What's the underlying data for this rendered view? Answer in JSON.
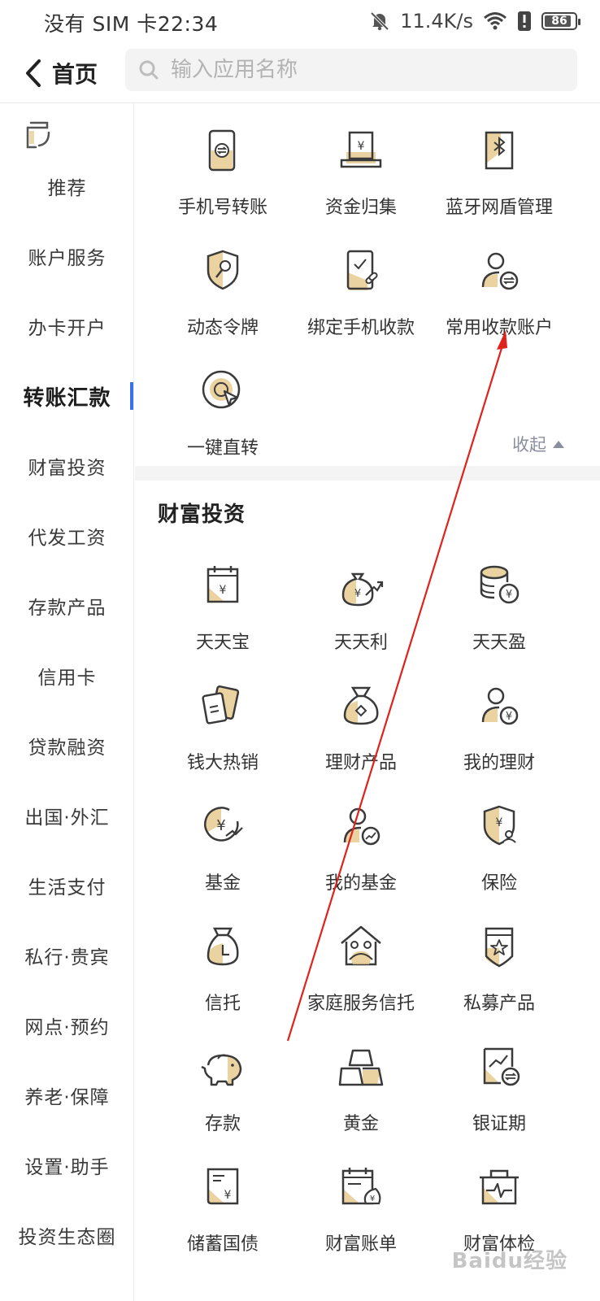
{
  "status_bar": {
    "left_text": "没有 SIM 卡22:34",
    "speed": "11.4K/s",
    "battery": "86"
  },
  "header": {
    "back_label": "首页",
    "search_placeholder": "输入应用名称"
  },
  "sidebar": {
    "items": [
      {
        "label": "推荐"
      },
      {
        "label": "账户服务"
      },
      {
        "label": "办卡开户"
      },
      {
        "label": "转账汇款",
        "active": true
      },
      {
        "label": "财富投资"
      },
      {
        "label": "代发工资"
      },
      {
        "label": "存款产品"
      },
      {
        "label": "信用卡"
      },
      {
        "label": "贷款融资"
      },
      {
        "label": "出国·外汇"
      },
      {
        "label": "生活支付"
      },
      {
        "label": "私行·贵宾"
      },
      {
        "label": "网点·预约"
      },
      {
        "label": "养老·保障"
      },
      {
        "label": "设置·助手"
      },
      {
        "label": "投资生态圈"
      }
    ]
  },
  "transfer_section": {
    "items": [
      {
        "label": "手机号转账",
        "icon": "phone-transfer-icon"
      },
      {
        "label": "资金归集",
        "icon": "fund-collection-icon"
      },
      {
        "label": "蓝牙网盾管理",
        "icon": "bluetooth-shield-icon"
      },
      {
        "label": "动态令牌",
        "icon": "dynamic-token-icon"
      },
      {
        "label": "绑定手机收款",
        "icon": "bind-phone-receive-icon"
      },
      {
        "label": "常用收款账户",
        "icon": "payee-account-icon"
      },
      {
        "label": "一键直转",
        "icon": "one-click-transfer-icon"
      }
    ],
    "collapse_label": "收起"
  },
  "wealth_section": {
    "title": "财富投资",
    "items": [
      {
        "label": "天天宝",
        "icon": "calendar-yuan-icon"
      },
      {
        "label": "天天利",
        "icon": "money-bag-growth-icon"
      },
      {
        "label": "天天盈",
        "icon": "coin-stack-icon"
      },
      {
        "label": "钱大热销",
        "icon": "cards-hot-sale-icon"
      },
      {
        "label": "理财产品",
        "icon": "money-bag-icon"
      },
      {
        "label": "我的理财",
        "icon": "user-yuan-icon"
      },
      {
        "label": "基金",
        "icon": "fund-coin-icon"
      },
      {
        "label": "我的基金",
        "icon": "user-chart-icon"
      },
      {
        "label": "保险",
        "icon": "insurance-shield-icon"
      },
      {
        "label": "信托",
        "icon": "trust-bag-icon"
      },
      {
        "label": "家庭服务信托",
        "icon": "family-trust-icon"
      },
      {
        "label": "私募产品",
        "icon": "private-fund-icon"
      },
      {
        "label": "存款",
        "icon": "piggy-bank-icon"
      },
      {
        "label": "黄金",
        "icon": "gold-bars-icon"
      },
      {
        "label": "银证期",
        "icon": "bank-securities-icon"
      },
      {
        "label": "储蓄国债",
        "icon": "treasury-bond-icon"
      },
      {
        "label": "财富账单",
        "icon": "wealth-bill-icon"
      },
      {
        "label": "财富体检",
        "icon": "wealth-checkup-icon"
      }
    ]
  },
  "colors": {
    "accent_gold": "#e6c88a",
    "icon_stroke": "#3a3a3a",
    "active_indicator": "#3a72e8",
    "annotation_arrow": "#e0221c"
  },
  "watermark": "Baidu经验"
}
